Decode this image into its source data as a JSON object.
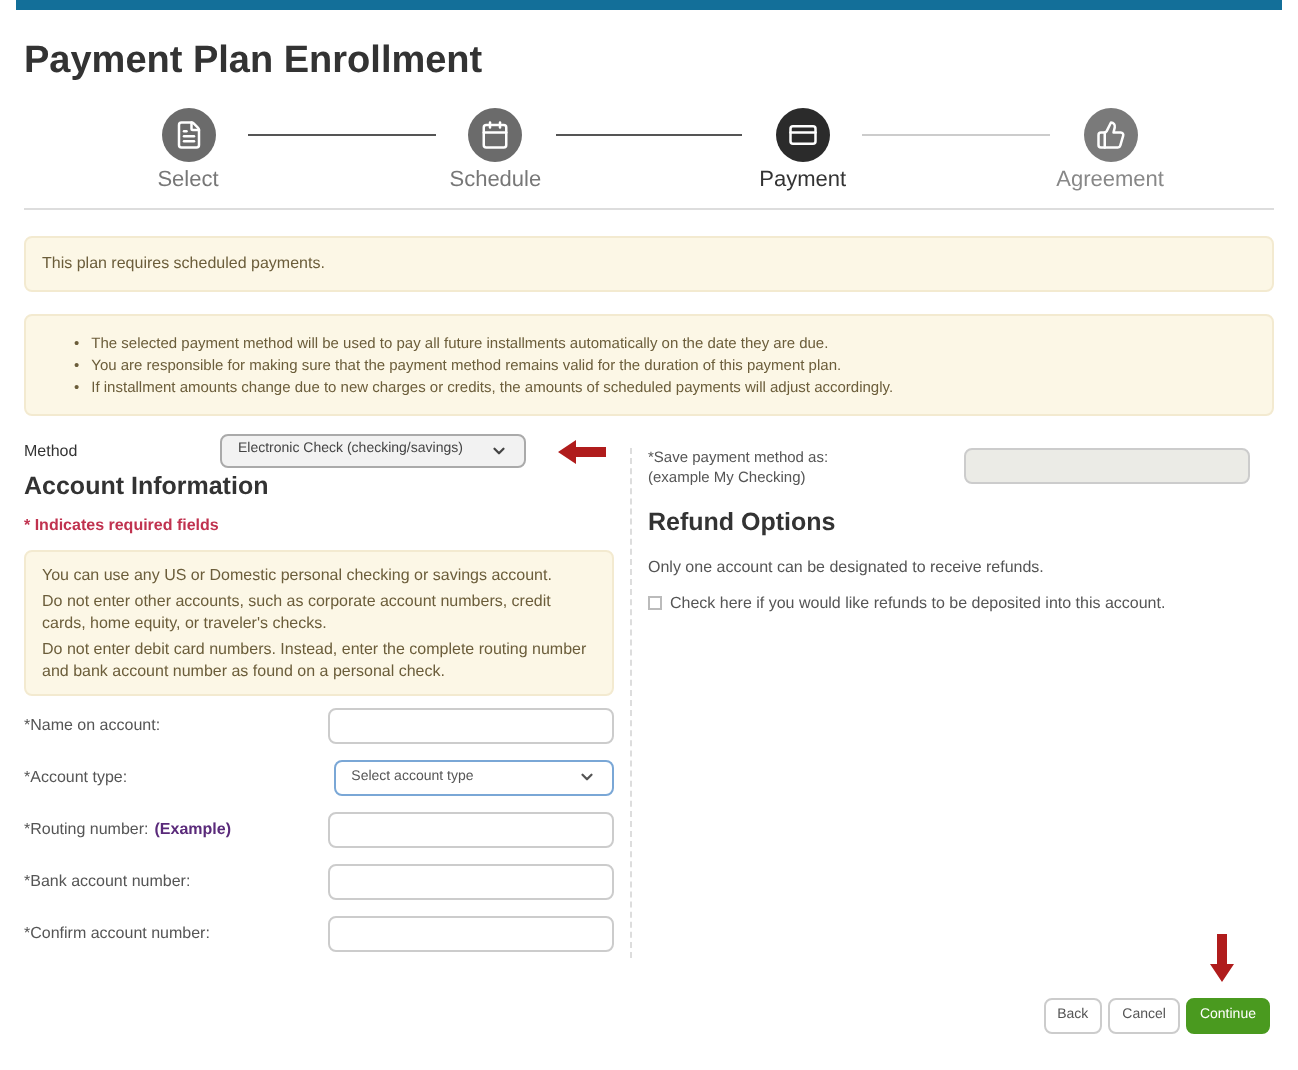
{
  "title": "Payment Plan Enrollment",
  "steps": [
    {
      "label": "Select",
      "selected": false,
      "completed": true
    },
    {
      "label": "Schedule",
      "selected": false,
      "completed": true
    },
    {
      "label": "Payment",
      "selected": true,
      "completed": false
    },
    {
      "label": "Agreement",
      "selected": false,
      "completed": false
    }
  ],
  "notice": "This plan requires scheduled payments.",
  "bullets": [
    {
      "marker": "•",
      "text": "The selected payment method will be used to pay all future installments automatically on the date they are due."
    },
    {
      "marker": "•",
      "text": "You are responsible for making sure that the payment method remains valid for the duration of this payment plan."
    },
    {
      "marker": "•",
      "text": "If installment amounts change due to new charges or credits, the amounts of scheduled payments will adjust accordingly."
    }
  ],
  "method": {
    "label": "Method",
    "value": "Electronic Check (checking/savings)"
  },
  "account": {
    "heading": "Account Information",
    "required_note": "* Indicates required fields",
    "info": [
      "You can use any US or Domestic personal checking or savings account.",
      "Do not enter other accounts, such as corporate account numbers, credit cards, home equity, or traveler's checks.",
      "Do not enter debit card numbers. Instead, enter the complete routing number and bank account number as found on a personal check."
    ],
    "fields": [
      {
        "kind": "text",
        "label": "*Name on account:"
      },
      {
        "kind": "select",
        "label": "*Account type:",
        "value": "Select account type"
      },
      {
        "kind": "text",
        "label": "*Routing number:",
        "link": "(Example)"
      },
      {
        "kind": "text",
        "label": "*Bank account number:"
      },
      {
        "kind": "text",
        "label": "*Confirm account number:"
      }
    ]
  },
  "save_as": {
    "label": "*Save payment method as:",
    "hint": "(example My Checking)",
    "disabled": true
  },
  "refund": {
    "heading": "Refund Options",
    "text": "Only one account can be designated to receive refunds.",
    "checkbox": {
      "label": "Check here if you would like refunds to be deposited into this account.",
      "checked": false
    }
  },
  "buttons": [
    {
      "label": "Back",
      "kind": "default"
    },
    {
      "label": "Cancel",
      "kind": "default"
    },
    {
      "label": "Continue",
      "kind": "primary"
    }
  ]
}
